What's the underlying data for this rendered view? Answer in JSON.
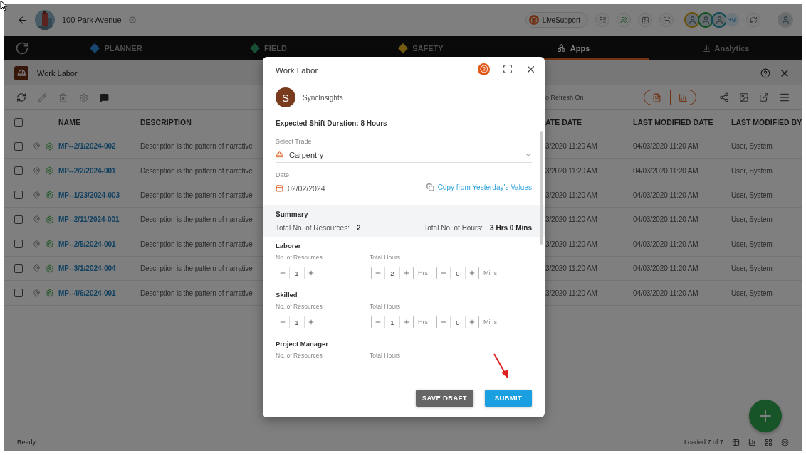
{
  "header": {
    "project": "100 Park Avenue",
    "live_support": "LiveSupport",
    "more_users": "+9"
  },
  "nav": [
    {
      "label": "PLANNER",
      "selected": false,
      "kind": "diamond"
    },
    {
      "label": "FIELD",
      "selected": false,
      "kind": "diamond"
    },
    {
      "label": "SAFETY",
      "selected": false,
      "kind": "diamond"
    },
    {
      "label": "Apps",
      "selected": true,
      "kind": "apps"
    },
    {
      "label": "Analytics",
      "selected": false,
      "kind": "chart"
    }
  ],
  "module": {
    "title": "Work Labor"
  },
  "toolbar": {
    "refresh_status": "o Refresh On"
  },
  "table": {
    "select_all_checked": false,
    "columns": [
      "NAME",
      "DESCRIPTION",
      "ATE DATE",
      "LAST MODIFIED DATE",
      "LAST MODIFIED BY"
    ],
    "rows": [
      {
        "checked": false,
        "name": "MP--2/1/2024-002",
        "description": "Description is the pattern of narrative",
        "column_3": "3/2020  11:20 AM",
        "last_modified_date": "04/03/2020  11:20 AM",
        "last_modified_by": "User, System"
      },
      {
        "checked": false,
        "name": "MP--2/2/2024-001",
        "description": "Description is the pattern of narrative",
        "column_3": "3/2020  11:20 AM",
        "last_modified_date": "04/03/2020  11:20 AM",
        "last_modified_by": "User, System"
      },
      {
        "checked": false,
        "name": "MP--1/23/2024-003",
        "description": "Description is the pattern of narrative",
        "column_3": "3/2020  11:20 AM",
        "last_modified_date": "04/03/2020  11:20 AM",
        "last_modified_by": "User, System"
      },
      {
        "checked": false,
        "name": "MP--2/11/2024-001",
        "description": "Description is the pattern of narrative",
        "column_3": "3/2020  11:20 AM",
        "last_modified_date": "04/03/2020  11:20 AM",
        "last_modified_by": "User, System"
      },
      {
        "checked": false,
        "name": "MP--2/5/2024-001",
        "description": "Description is the pattern of narrative",
        "column_3": "3/2020  11:20 AM",
        "last_modified_date": "04/03/2020  11:20 AM",
        "last_modified_by": "User, System"
      },
      {
        "checked": false,
        "name": "MP--3/1/2024-004",
        "description": "Description is the pattern of narrative",
        "column_3": "3/2020  11:20 AM",
        "last_modified_date": "04/03/2020  11:20 AM",
        "last_modified_by": "User, System"
      },
      {
        "checked": false,
        "name": "MP--4/6/2024-001",
        "description": "Description is the pattern of narrative",
        "column_3": "3/2020  11:20 AM",
        "last_modified_date": "04/03/2020  11:20 AM",
        "last_modified_by": "User, System"
      }
    ]
  },
  "status_bar": {
    "status": "Ready",
    "loaded": "Loaded 7 of 7"
  },
  "dialog": {
    "title": "Work Labor",
    "user_initial": "S",
    "user": "SyncInsights",
    "shift": "Expected Shift Duration: 8 Hours",
    "trade": {
      "label": "Select Trade",
      "value": "Carpentry"
    },
    "date": {
      "label": "Date",
      "value": "02/02/2024"
    },
    "copy_link": "Copy from Yesterday's Values",
    "summary": {
      "title": "Summary",
      "resources_label": "Total No. of Resources:",
      "resources_value": "2",
      "hours_label": "Total No. of Hours:",
      "hours_value": "3 Hrs 0 Mins"
    },
    "sections": [
      {
        "title": "Laborer",
        "resources_label": "No. of Resources",
        "hours_label": "Total Hours",
        "steppers": [
          {
            "kind": "count",
            "value": "1"
          },
          {
            "kind": "time",
            "value": "2",
            "unit": "Hrs"
          },
          {
            "kind": "time",
            "value": "0",
            "unit": "Mins"
          }
        ]
      },
      {
        "title": "Skilled",
        "resources_label": "No. of Resources",
        "hours_label": "Total Hours",
        "steppers": [
          {
            "kind": "count",
            "value": "1"
          },
          {
            "kind": "time",
            "value": "1",
            "unit": "Hrs"
          },
          {
            "kind": "time",
            "value": "0",
            "unit": "Mins"
          }
        ]
      },
      {
        "title": "Project Manager",
        "resources_label": "No. of Resources",
        "hours_label": "Total Hours"
      }
    ],
    "buttons": [
      {
        "kind": "secondary",
        "label": "SAVE DRAFT"
      },
      {
        "kind": "primary",
        "label": "SUBMIT"
      }
    ]
  }
}
